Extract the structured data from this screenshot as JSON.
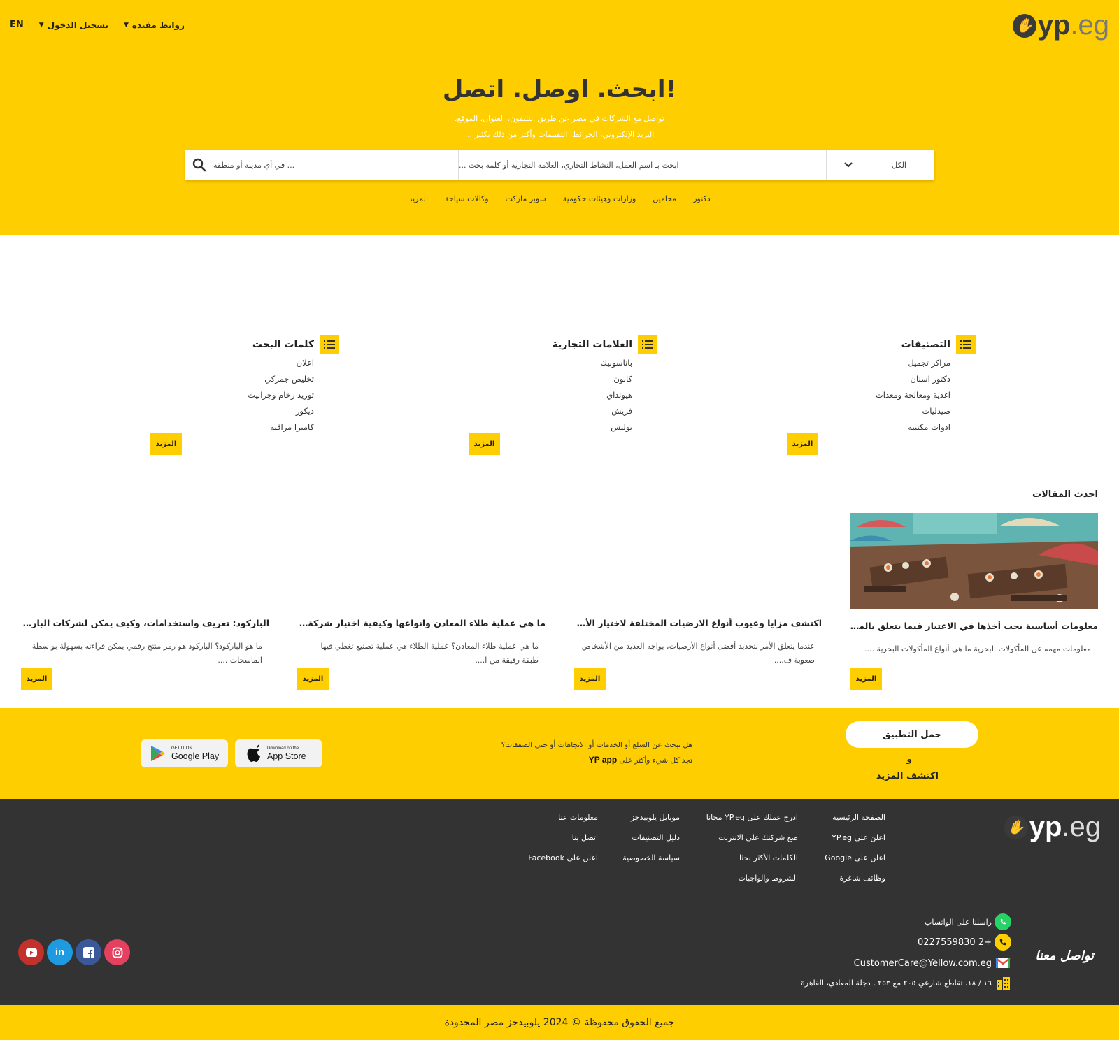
{
  "brand": {
    "logo_mark": "✋",
    "logo_yp": "yp",
    "logo_dot_eg": ".eg"
  },
  "topnav": {
    "lang": "EN",
    "login": "تسجيل الدخول",
    "links": "روابط مفيدة"
  },
  "hero": {
    "title": "ابحث. اوصل. اتصل!",
    "subtitle_line1": "تواصل مع الشركات في مصر عن طريق التليفون، العنوان، الموقع،",
    "subtitle_line2": "البريد الإلكتروني، الخرائط، التقييمات وأكثر من ذلك بكثير ..."
  },
  "search": {
    "category_value": "الكل",
    "keyword_placeholder": "ابحث بـ اسم العمل، النشاط التجاري، العلامة التجارية أو كلمة بحث ...",
    "location_placeholder": "... في أي مدينة أو منطقة"
  },
  "quick_links": [
    "دكتور",
    "محامين",
    "وزارات وهيئات حكومية",
    "سوبر ماركت",
    "وكالات سياحة",
    "المزيد"
  ],
  "directory": {
    "more_label": "المزيد",
    "categories": {
      "title": "التصنيفات",
      "items": [
        "مراكز تجميل",
        "دكتور اسنان",
        "اغذية ومعالجة ومعدات",
        "صيدليات",
        "ادوات مكتبية"
      ]
    },
    "brands": {
      "title": "العلامات التجارية",
      "items": [
        "باناسونيك",
        "كانون",
        "هيونداي",
        "فريش",
        "بوليس"
      ]
    },
    "keywords": {
      "title": "كلمات البحث",
      "items": [
        "اعلان",
        "تخليص جمركي",
        "توريد رخام وجرانيت",
        "ديكور",
        "كاميرا مراقبة"
      ]
    }
  },
  "articles": {
    "section_title": "احدث المقالات",
    "more_label": "المزيد",
    "items": [
      {
        "title": "معلومات أساسية يجب أخذها في الاعتبار فيما يتعلق بالمأكولات البحرية",
        "excerpt": "معلومات مهمه عن المأكولات البحرية  ما هي أنواع المأكولات البحرية ....",
        "has_image": true
      },
      {
        "title": "اكتشف مزايا وعيوب أنواع الارضيات المختلفة لاختيار الأفضل لمنزلك",
        "excerpt": "عندما يتعلق الأمر بتحديد أفضل أنواع الأرضيات، يواجه العديد من الأشخاص صعوبة ف....",
        "has_image": false
      },
      {
        "title": "ما هي عملية طلاء المعادن وانواعها وكيفية اختيار شركة الطلاء المعدنية المناسبة",
        "excerpt": "ما هي عملية طلاء المعادن؟ عملية الطلاء هي عملية تصنيع تغطي فيها طبقة رقيقة من ا....",
        "has_image": false
      },
      {
        "title": "الباركود: تعريف واستخدامات، وكيف يمكن لشركات الباركود مساعدتك في أعمالك",
        "excerpt": "ما هو الباركود؟ الباركود هو رمز منتج رقمي يمكن قراءته بسهولة بواسطة الماسحات ....",
        "has_image": false
      }
    ]
  },
  "app_section": {
    "download_button": "حمل التطبيق",
    "and": "و",
    "discover": "اكتشف المزيد",
    "question": "هل تبحث عن السلع أو الخدمات أو الاتجاهات أو حتى الصفقات؟",
    "find_line": "تجد كل شيء وأكثر على",
    "app_name": "YP app",
    "app_store_small": "Download on the",
    "app_store_big": "App Store",
    "google_play_small": "GET IT ON",
    "google_play_big": "Google Play"
  },
  "footer": {
    "col1": [
      "الصفحة الرئيسية",
      "اعلن على YP.eg",
      "اعلن على Google",
      "وظائف شاغرة"
    ],
    "col2": [
      "ادرج عملك على YP.eg مجانا",
      "ضع شركتك على الانترنت",
      "الكلمات الأكثر بحثا",
      "الشروط والواجبات"
    ],
    "col3": [
      "موبايل يلوبيدجز",
      "دليل التصنيفات",
      "سياسة الخصوصية"
    ],
    "col4": [
      "معلومات عنا",
      "اتصل بنا",
      "اعلن على Facebook"
    ],
    "contact_title": "تواصل معنا",
    "whatsapp": "راسلنا على الواتساب",
    "phone": "0227559830 2+",
    "email": "CustomerCare@Yellow.com.eg",
    "address": "١٦ / ١٨، تقاطع شارعي ٢٠٥ مع ٢٥٣ , دجلة المعادي، القاهرة",
    "social_colors": {
      "youtube": "#c4302b",
      "linkedin": "#1e9ae0",
      "facebook": "#3b5998",
      "instagram": "#e4405f"
    },
    "whatsapp_color": "#25d366",
    "phone_color": "#ffce00"
  },
  "copyright": "جميع الحقوق محفوظة © 2024 يلوبيدجز مصر المحدودة",
  "colors": {
    "brand_yellow": "#ffce00",
    "footer_dark": "#333333"
  }
}
